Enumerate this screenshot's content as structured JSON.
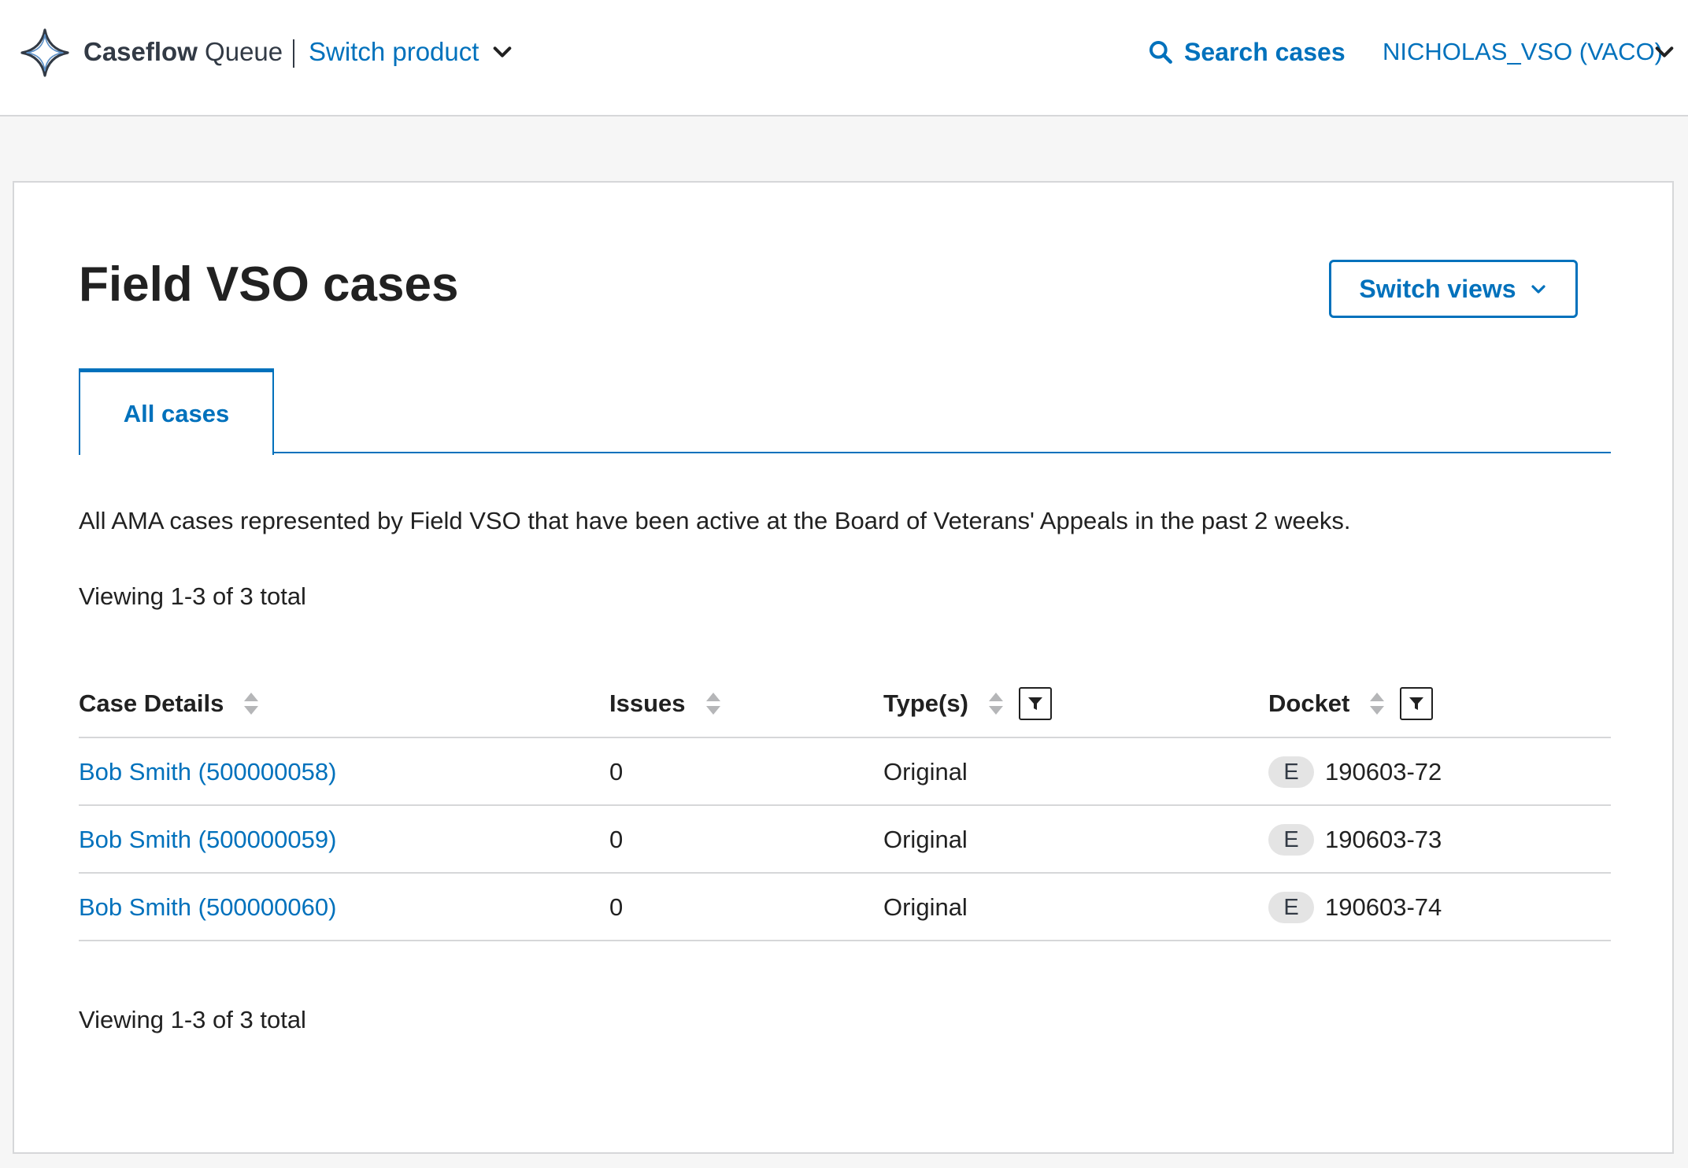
{
  "header": {
    "brand_name": "Caseflow",
    "app_name": "Queue",
    "switch_product_label": "Switch product",
    "search_label": "Search cases",
    "user_label": "NICHOLAS_VSO (VACO)",
    "logo_icon": "caseflow-star-logo",
    "colors": {
      "link": "#0071bc",
      "text": "#323a45"
    }
  },
  "page": {
    "title": "Field VSO cases",
    "switch_views_label": "Switch views",
    "tabs": [
      {
        "label": "All cases",
        "active": true
      }
    ],
    "description": "All AMA cases represented by Field VSO that have been active at the Board of Veterans' Appeals in the past 2 weeks.",
    "viewing_top": "Viewing 1-3 of 3 total",
    "viewing_bottom": "Viewing 1-3 of 3 total"
  },
  "table": {
    "columns": [
      {
        "label": "Case Details",
        "sortable": true,
        "filterable": false
      },
      {
        "label": "Issues",
        "sortable": true,
        "filterable": false
      },
      {
        "label": "Type(s)",
        "sortable": true,
        "filterable": true
      },
      {
        "label": "Docket",
        "sortable": true,
        "filterable": true
      }
    ],
    "rows": [
      {
        "case": "Bob Smith (500000058)",
        "issues": "0",
        "type": "Original",
        "docket_badge": "E",
        "docket_number": "190603-72"
      },
      {
        "case": "Bob Smith (500000059)",
        "issues": "0",
        "type": "Original",
        "docket_badge": "E",
        "docket_number": "190603-73"
      },
      {
        "case": "Bob Smith (500000060)",
        "issues": "0",
        "type": "Original",
        "docket_badge": "E",
        "docket_number": "190603-74"
      }
    ]
  }
}
